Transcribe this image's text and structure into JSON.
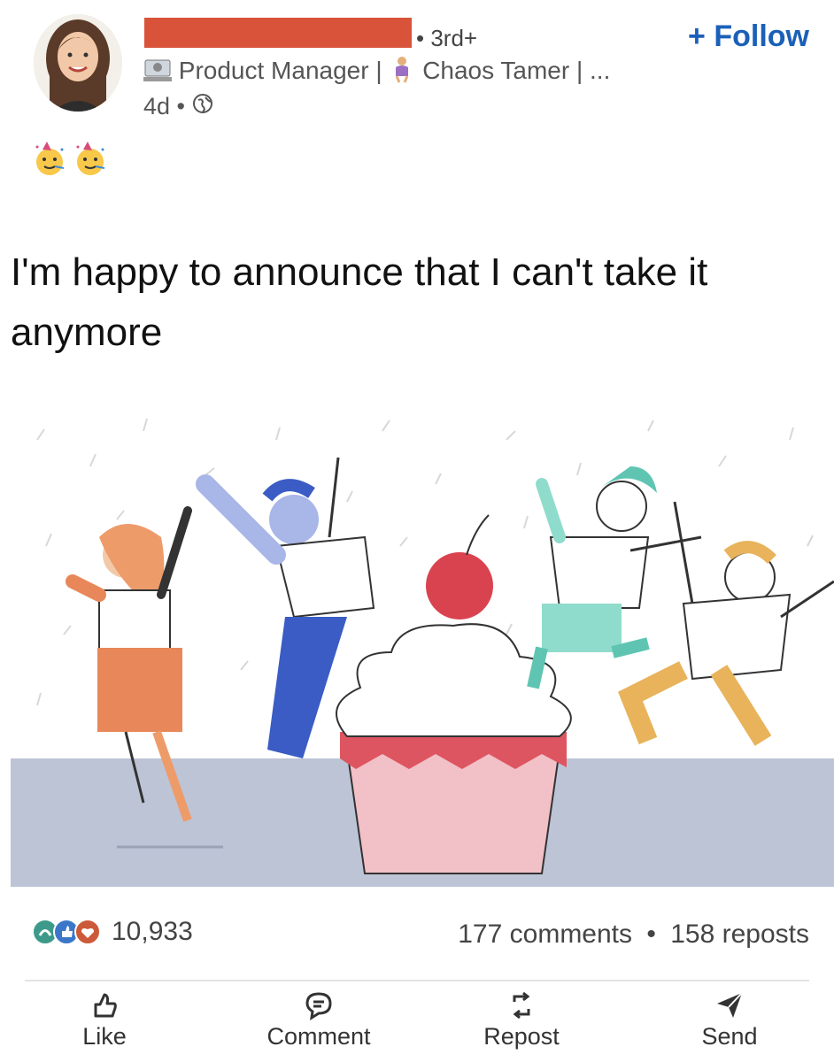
{
  "post": {
    "author_headline_role": "Product Manager |",
    "author_headline_tag": "Chaos Tamer | ...",
    "connection_degree": "• 3rd+",
    "follow_label": "+ Follow",
    "age": "4d •",
    "text": "I'm happy to announce that I can't take it anymore"
  },
  "engagement": {
    "reaction_count": "10,933",
    "comments": "177 comments",
    "reposts": "158 reposts",
    "separator": "•"
  },
  "actions": {
    "like": "Like",
    "comment": "Comment",
    "repost": "Repost",
    "send": "Send"
  },
  "icons": [
    "globe-icon",
    "party-face-icon",
    "like-icon",
    "comment-icon",
    "repost-icon",
    "send-icon"
  ],
  "colors": {
    "follow": "#1b60b8",
    "redaction": "#d9533a",
    "reaction_celebrate": "#3d9a8a",
    "reaction_like": "#3a77c9",
    "reaction_love": "#cc5a3a"
  }
}
